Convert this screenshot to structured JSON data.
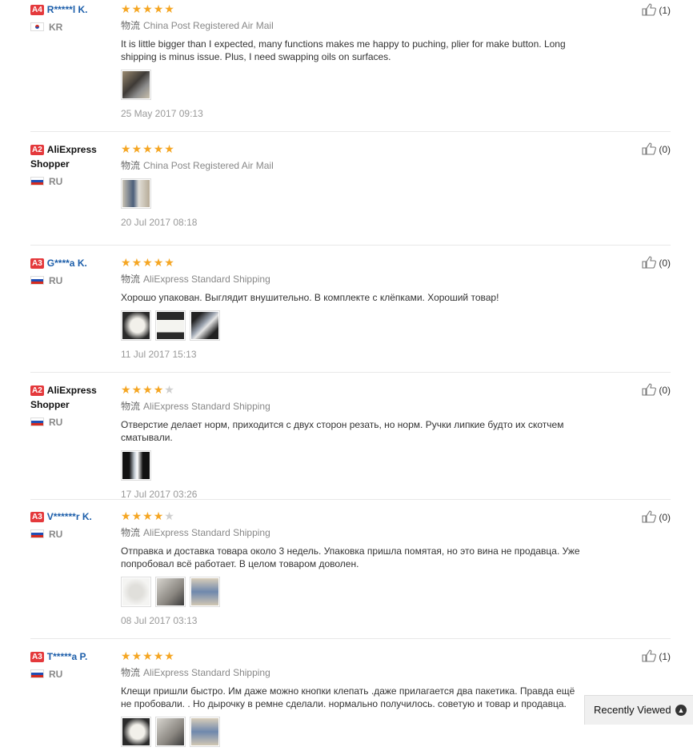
{
  "reviews": [
    {
      "level": "A4",
      "name": "R*****l K.",
      "name_style": "link",
      "country": "KR",
      "flag": "kr",
      "stars": 5,
      "shipping_cn": "物流",
      "shipping": "China Post Registered Air Mail",
      "text": "It is little bigger than I expected, many functions makes me happy to puching, plier for make button. Long shipping is minus issue. Plus, I need swapping oils on surfaces.",
      "photos": [
        "p1"
      ],
      "date": "25 May 2017 09:13",
      "likes": "(1)"
    },
    {
      "level": "A2",
      "name": "AliExpress Shopper",
      "name_style": "plain",
      "country": "RU",
      "flag": "ru",
      "stars": 5,
      "shipping_cn": "物流",
      "shipping": "China Post Registered Air Mail",
      "text": "",
      "photos": [
        "p2"
      ],
      "date": "20 Jul 2017 08:18",
      "likes": "(0)"
    },
    {
      "level": "A3",
      "name": "G****a K.",
      "name_style": "link",
      "country": "RU",
      "flag": "ru",
      "stars": 5,
      "shipping_cn": "物流",
      "shipping": "AliExpress Standard Shipping",
      "text": "Хорошо упакован. Выглядит внушительно. В комплекте с клёпками. Хороший товар!",
      "photos": [
        "p3",
        "p4",
        "p5"
      ],
      "date": "11 Jul 2017 15:13",
      "likes": "(0)"
    },
    {
      "level": "A2",
      "name": "AliExpress Shopper",
      "name_style": "plain",
      "country": "RU",
      "flag": "ru",
      "stars": 4,
      "shipping_cn": "物流",
      "shipping": "AliExpress Standard Shipping",
      "text": "Отверстие делает норм, приходится с двух сторон резать, но норм. Ручки липкие будто их скотчем сматывали.",
      "photos": [
        "p6"
      ],
      "date": "17 Jul 2017 03:26",
      "likes": "(0)"
    },
    {
      "level": "A3",
      "name": "V******r K.",
      "name_style": "link",
      "country": "RU",
      "flag": "ru",
      "stars": 4,
      "shipping_cn": "物流",
      "shipping": "AliExpress Standard Shipping",
      "text": "Отправка и доставка товара около 3 недель. Упаковка пришла помятая, но это вина не продавца. Уже попробовал всё работает. В целом товаром доволен.",
      "photos": [
        "p7",
        "p8",
        "p9"
      ],
      "date": "08 Jul 2017 03:13",
      "likes": "(0)"
    },
    {
      "level": "A3",
      "name": "T*****a P.",
      "name_style": "link",
      "country": "RU",
      "flag": "ru",
      "stars": 5,
      "shipping_cn": "物流",
      "shipping": "AliExpress Standard Shipping",
      "text": "Клещи пришли быстро. Им даже можно кнопки клепать .даже прилагается два пакетика. Правда ещё не пробовали. . Но дырочку в ремне сделали. нормально получилось. советую и товар и продавца.",
      "photos": [
        "p3",
        "p8",
        "p9"
      ],
      "date": "",
      "likes": "(1)"
    }
  ],
  "recently_viewed": {
    "label": "Recently Viewed",
    "icon": "chevron-up-icon"
  },
  "colors": {
    "star": "#f5a623",
    "level_badge": "#e4393c",
    "username": "#1c5eaa"
  }
}
